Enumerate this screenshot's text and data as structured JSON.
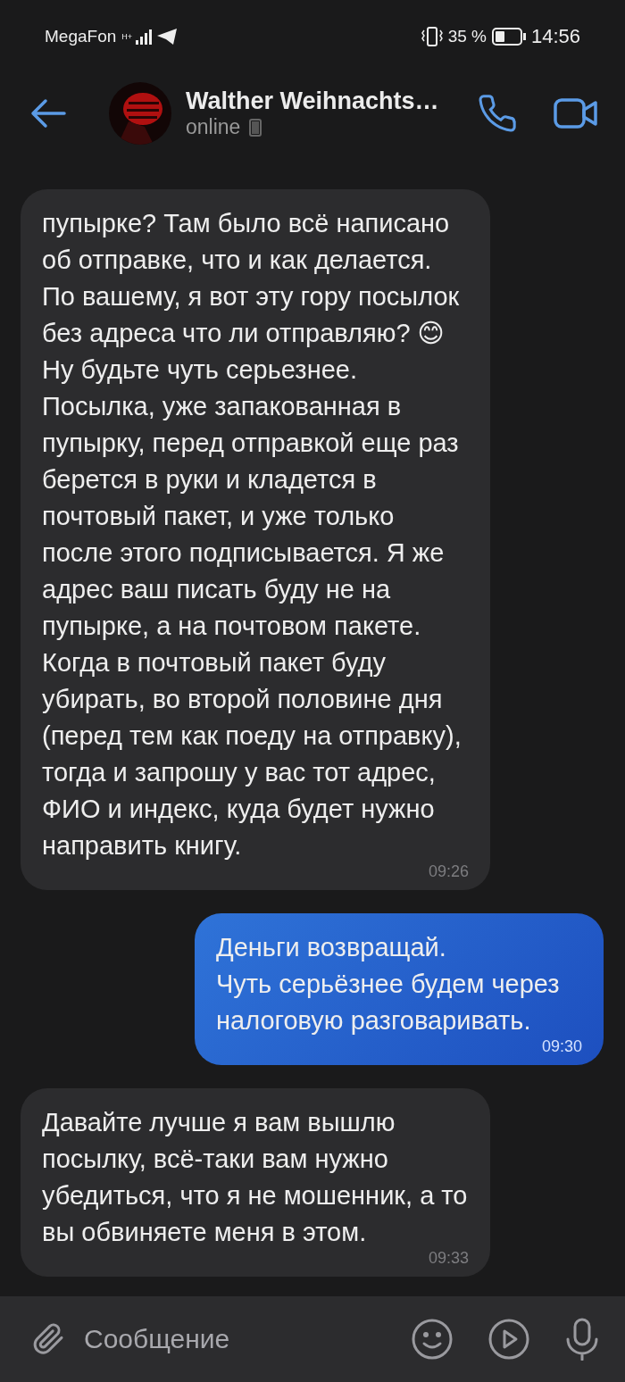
{
  "status_bar": {
    "carrier": "MegaFon",
    "network": "H+",
    "battery": "35 %",
    "time": "14:56"
  },
  "header": {
    "name": "Walther Weihnachts…",
    "status": "online"
  },
  "messages": [
    {
      "outgoing": false,
      "text": "пупырке? Там было всё написано об отправке, что и как делается. По вашему, я вот эту гору посылок без адреса что ли отправляю? 😊 Ну будьте чуть серьезнее. Посылка, уже запакованная в пупырку, перед отправкой еще раз берется в руки и кладется в почтовый пакет, и уже только после этого подписывается. Я же адрес ваш писать буду не на пупырке, а на почтовом пакете. Когда в почтовый пакет буду убирать, во второй половине дня (перед тем как поеду на отправку), тогда и запрошу у вас тот адрес, ФИО и индекс, куда будет нужно направить книгу.",
      "time": "09:26"
    },
    {
      "outgoing": true,
      "text": "Деньги возвращай.\nЧуть серьёзнее будем через налоговую разговаривать.",
      "time": "09:30"
    },
    {
      "outgoing": false,
      "text": "Давайте лучше я вам вышлю посылку, всё-таки вам нужно убедиться, что я не мошенник, а то вы обвиняете меня в этом.",
      "time": "09:33"
    }
  ],
  "composer": {
    "placeholder": "Сообщение"
  }
}
